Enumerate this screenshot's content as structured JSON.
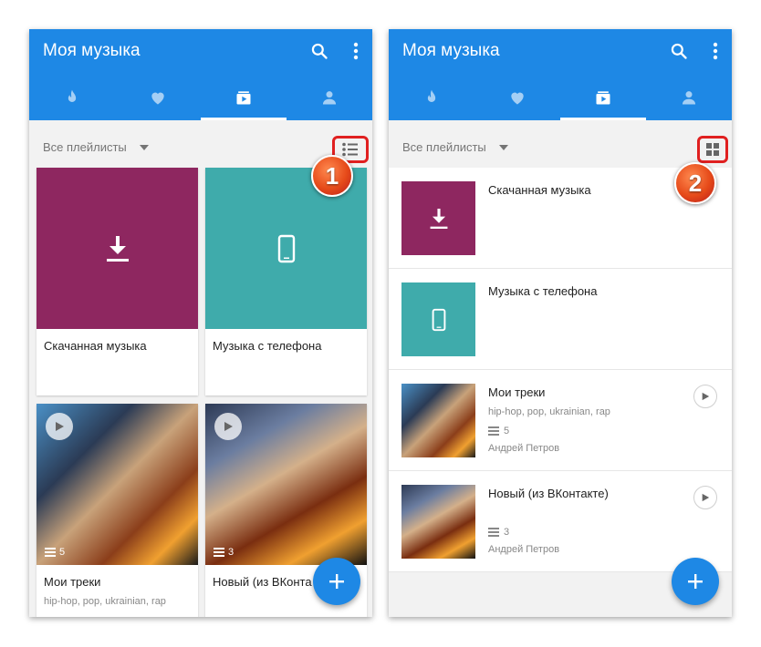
{
  "app": {
    "title": "Моя музыка",
    "accent": "#1e88e5",
    "tabs": [
      {
        "icon": "fire-icon",
        "active": false
      },
      {
        "icon": "heart-icon",
        "active": false
      },
      {
        "icon": "playlist-icon",
        "active": true
      },
      {
        "icon": "person-icon",
        "active": false
      }
    ]
  },
  "filter": {
    "label": "Все плейлисты"
  },
  "annotations": {
    "step1": "1",
    "step2": "2",
    "highlight_color": "#e02020"
  },
  "playlists": [
    {
      "name": "Скачанная музыка",
      "color": "#8e2760",
      "icon": "download-icon"
    },
    {
      "name": "Музыка с телефона",
      "color": "#3fabab",
      "icon": "phone-icon"
    },
    {
      "name": "Мои треки",
      "tags": "hip-hop, pop, ukrainian, rap",
      "count": "5",
      "author": "Андрей Петров"
    },
    {
      "name": "Новый (из ВКонтакте)",
      "name_truncated": "Новый (из ВКонта",
      "count": "3",
      "author": "Андрей Петров"
    }
  ]
}
